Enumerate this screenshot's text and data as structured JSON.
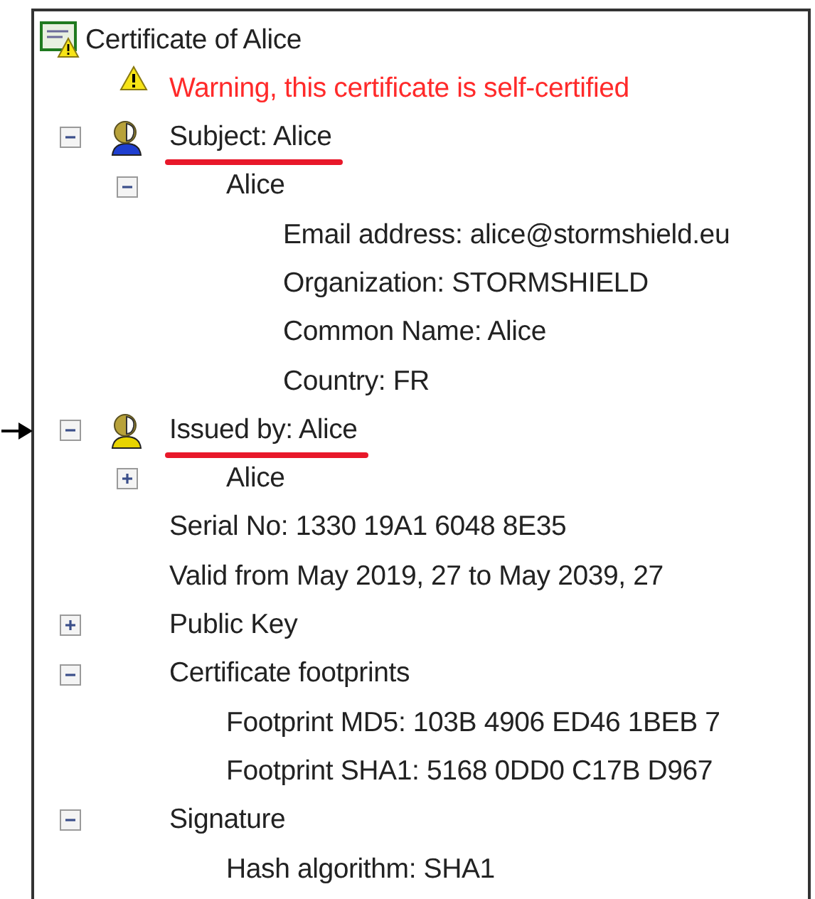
{
  "tree": {
    "label": "Certificate of Alice",
    "kind": "certificate",
    "children": [
      {
        "label": "Warning, this certificate is self-certified",
        "kind": "warning"
      },
      {
        "label": "Subject: Alice",
        "kind": "subject",
        "expanded": true,
        "highlighted": true,
        "pointed": false,
        "children": [
          {
            "label": "Alice",
            "expanded": true,
            "children": [
              {
                "label": "Email address: alice@stormshield.eu"
              },
              {
                "label": "Organization: STORMSHIELD"
              },
              {
                "label": "Common Name: Alice"
              },
              {
                "label": "Country: FR"
              }
            ]
          }
        ]
      },
      {
        "label": "Issued by: Alice",
        "kind": "issuer",
        "expanded": true,
        "highlighted": true,
        "pointed": true,
        "children": [
          {
            "label": "Alice",
            "expanded": false
          }
        ]
      },
      {
        "label": "Serial No: 1330 19A1 6048 8E35"
      },
      {
        "label": "Valid from May 2019, 27 to May 2039, 27"
      },
      {
        "label": "Public Key",
        "expanded": false
      },
      {
        "label": "Certificate footprints",
        "expanded": true,
        "children": [
          {
            "label": "Footprint MD5: 103B 4906 ED46 1BEB 7"
          },
          {
            "label": "Footprint SHA1: 5168 0DD0 C17B D967"
          }
        ]
      },
      {
        "label": "Signature",
        "expanded": true,
        "children": [
          {
            "label": "Hash algorithm: SHA1"
          }
        ]
      }
    ]
  }
}
